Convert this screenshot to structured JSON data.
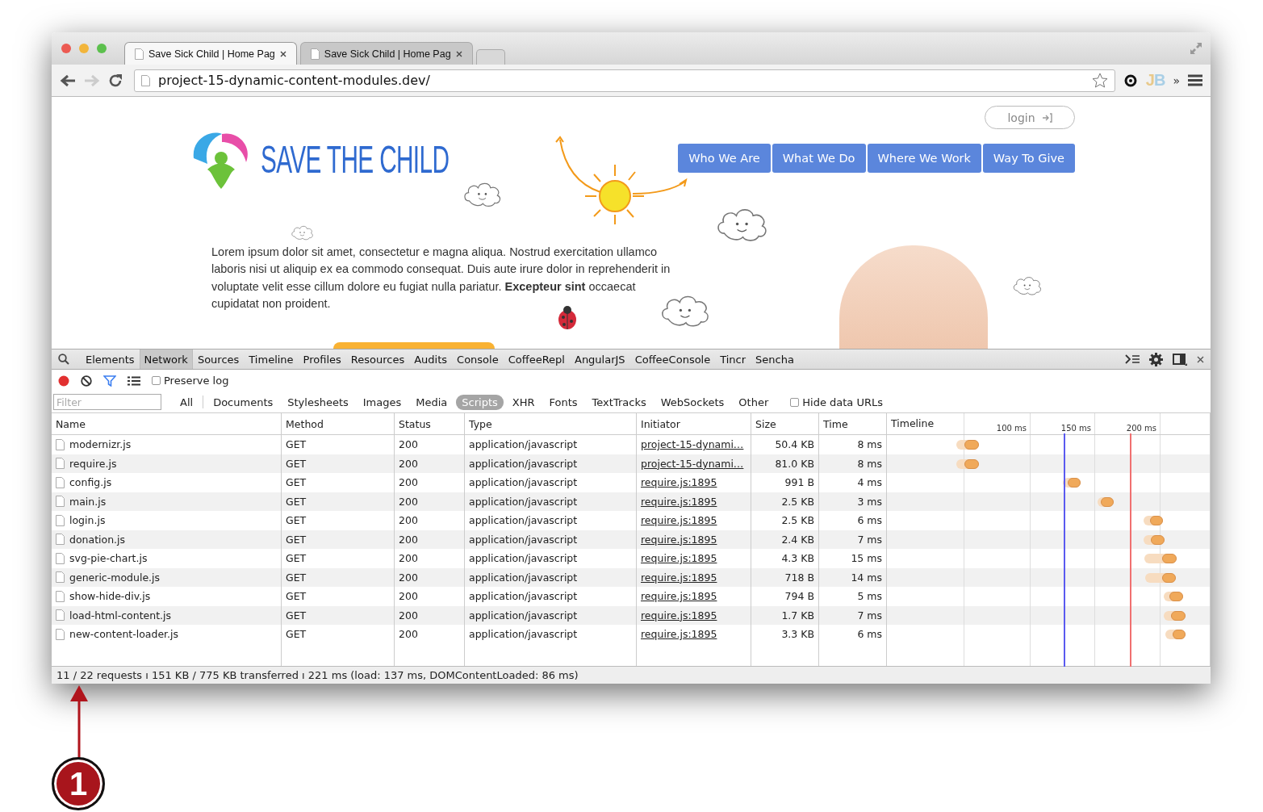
{
  "browser": {
    "tabs": [
      {
        "title": "Save Sick Child | Home Pag",
        "selected": true
      },
      {
        "title": "Save Sick Child | Home Pag",
        "selected": false
      }
    ],
    "address": {
      "value": "project-15-dynamic-content-modules.dev/"
    },
    "extension_label": "JB",
    "overflow": "»"
  },
  "page": {
    "login_label": "login",
    "brand": "SAVE THE CHILD",
    "nav": [
      "Who We Are",
      "What We Do",
      "Where We Work",
      "Way To Give"
    ],
    "paragraph": "Lorem ipsum dolor sit amet, consectetur e magna aliqua. Nostrud exercitation ullamco laboris nisi ut aliquip ex ea commodo consequat. Duis aute irure dolor in reprehenderit in voluptate velit esse cillum dolore eu fugiat nulla pariatur. **Excepteur sint** occaecat cupidatat non proident."
  },
  "devtools": {
    "panels": [
      {
        "label": "Elements",
        "selected": false
      },
      {
        "label": "Network",
        "selected": true
      },
      {
        "label": "Sources",
        "selected": false
      },
      {
        "label": "Timeline",
        "selected": false
      },
      {
        "label": "Profiles",
        "selected": false
      },
      {
        "label": "Resources",
        "selected": false
      },
      {
        "label": "Audits",
        "selected": false
      },
      {
        "label": "Console",
        "selected": false
      },
      {
        "label": "CoffeeRepl",
        "selected": false
      },
      {
        "label": "AngularJS",
        "selected": false
      },
      {
        "label": "CoffeeConsole",
        "selected": false
      },
      {
        "label": "Tincr",
        "selected": false
      },
      {
        "label": "Sencha",
        "selected": false
      }
    ],
    "recording": true,
    "preserve_log": {
      "label": "Preserve log",
      "checked": false
    },
    "filter": {
      "placeholder": "Filter"
    },
    "type_filters": [
      {
        "label": "All",
        "selected": false
      },
      {
        "label": "Documents",
        "selected": false
      },
      {
        "label": "Stylesheets",
        "selected": false
      },
      {
        "label": "Images",
        "selected": false
      },
      {
        "label": "Media",
        "selected": false
      },
      {
        "label": "Scripts",
        "selected": true
      },
      {
        "label": "XHR",
        "selected": false
      },
      {
        "label": "Fonts",
        "selected": false
      },
      {
        "label": "TextTracks",
        "selected": false
      },
      {
        "label": "WebSockets",
        "selected": false
      },
      {
        "label": "Other",
        "selected": false
      }
    ],
    "hide_data_urls": {
      "label": "Hide data URLs",
      "checked": false
    },
    "columns": [
      "Name",
      "Method",
      "Status",
      "Type",
      "Initiator",
      "Size",
      "Time",
      "Timeline"
    ],
    "timeline_ticks": [
      "100 ms",
      "150 ms",
      "200 ms"
    ],
    "rows": [
      {
        "name": "modernizr.js",
        "method": "GET",
        "status": "200",
        "type": "application/javascript",
        "initiator": "project-15-dynami…",
        "size": "50.4 KB",
        "time": "8 ms"
      },
      {
        "name": "require.js",
        "method": "GET",
        "status": "200",
        "type": "application/javascript",
        "initiator": "project-15-dynami…",
        "size": "81.0 KB",
        "time": "8 ms"
      },
      {
        "name": "config.js",
        "method": "GET",
        "status": "200",
        "type": "application/javascript",
        "initiator": "require.js:1895",
        "size": "991 B",
        "time": "4 ms"
      },
      {
        "name": "main.js",
        "method": "GET",
        "status": "200",
        "type": "application/javascript",
        "initiator": "require.js:1895",
        "size": "2.5 KB",
        "time": "3 ms"
      },
      {
        "name": "login.js",
        "method": "GET",
        "status": "200",
        "type": "application/javascript",
        "initiator": "require.js:1895",
        "size": "2.5 KB",
        "time": "6 ms"
      },
      {
        "name": "donation.js",
        "method": "GET",
        "status": "200",
        "type": "application/javascript",
        "initiator": "require.js:1895",
        "size": "2.4 KB",
        "time": "7 ms"
      },
      {
        "name": "svg-pie-chart.js",
        "method": "GET",
        "status": "200",
        "type": "application/javascript",
        "initiator": "require.js:1895",
        "size": "4.3 KB",
        "time": "15 ms"
      },
      {
        "name": "generic-module.js",
        "method": "GET",
        "status": "200",
        "type": "application/javascript",
        "initiator": "require.js:1895",
        "size": "718 B",
        "time": "14 ms"
      },
      {
        "name": "show-hide-div.js",
        "method": "GET",
        "status": "200",
        "type": "application/javascript",
        "initiator": "require.js:1895",
        "size": "794 B",
        "time": "5 ms"
      },
      {
        "name": "load-html-content.js",
        "method": "GET",
        "status": "200",
        "type": "application/javascript",
        "initiator": "require.js:1895",
        "size": "1.7 KB",
        "time": "7 ms"
      },
      {
        "name": "new-content-loader.js",
        "method": "GET",
        "status": "200",
        "type": "application/javascript",
        "initiator": "require.js:1895",
        "size": "3.3 KB",
        "time": "6 ms"
      }
    ],
    "status_bar": "11 / 22 requests ı 151 KB / 775 KB transferred ı 221 ms (load: 137 ms, DOMContentLoaded: 86 ms)"
  },
  "annotation": {
    "number": "1"
  }
}
